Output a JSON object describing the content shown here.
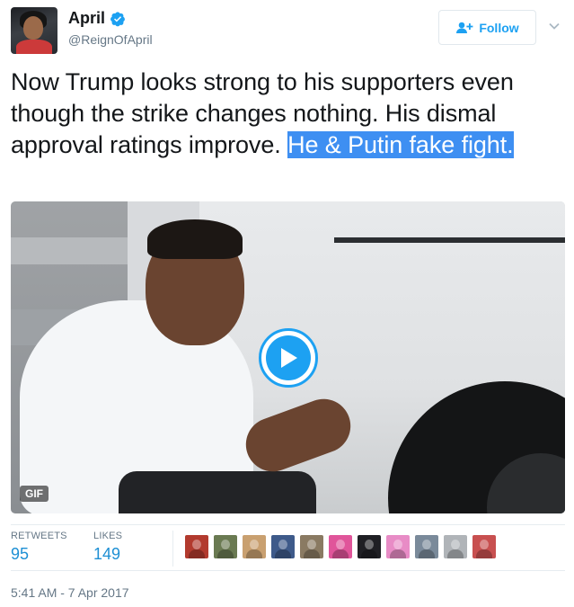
{
  "author": {
    "name": "April",
    "handle": "@ReignOfApril",
    "verified": true,
    "avatar_icon": "profile-photo"
  },
  "follow_button": {
    "label": "Follow",
    "icon": "add-user-icon",
    "color": "#1da1f2"
  },
  "more_menu_icon": "chevron-down-icon",
  "tweet": {
    "text_plain": "Now Trump looks strong to his supporters even though the strike changes nothing. His dismal approval ratings improve.",
    "text_highlighted": "He & Putin fake fight."
  },
  "media": {
    "type": "gif",
    "badge": "GIF",
    "play_icon": "play-icon"
  },
  "stats": {
    "retweets_label": "RETWEETS",
    "retweets_count": "95",
    "likes_label": "LIKES",
    "likes_count": "149"
  },
  "likers": [
    {
      "icon": "liker-avatar",
      "color": "#b23a2e"
    },
    {
      "icon": "liker-avatar",
      "color": "#6a7a52"
    },
    {
      "icon": "liker-avatar",
      "color": "#c9a070"
    },
    {
      "icon": "liker-avatar",
      "color": "#3e5a8a"
    },
    {
      "icon": "liker-avatar",
      "color": "#8a7a62"
    },
    {
      "icon": "liker-avatar",
      "color": "#e0559a"
    },
    {
      "icon": "liker-avatar",
      "color": "#1f1f24"
    },
    {
      "icon": "liker-avatar",
      "color": "#e88cc6"
    },
    {
      "icon": "liker-avatar",
      "color": "#7a8a9a"
    },
    {
      "icon": "liker-avatar",
      "color": "#b0b4b8"
    },
    {
      "icon": "liker-avatar",
      "color": "#c85050"
    }
  ],
  "timestamp": "5:41 AM - 7 Apr 2017",
  "colors": {
    "highlight_bg": "#3e8ff2",
    "link_blue": "#1d8fd4",
    "muted": "#657786"
  }
}
